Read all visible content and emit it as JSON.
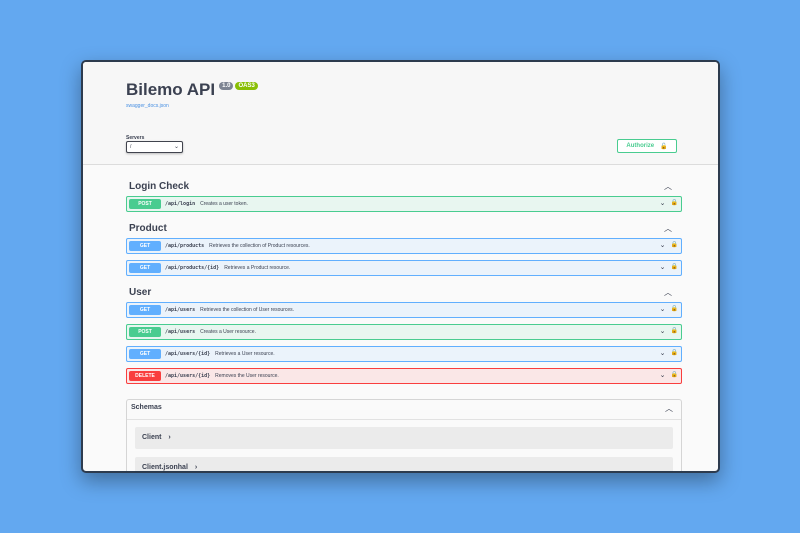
{
  "info": {
    "title": "Bilemo API",
    "version": "1.0",
    "oas": "OAS3",
    "doc_link": "swagger_docs.json"
  },
  "servers": {
    "label": "Servers",
    "selected": "/"
  },
  "authorize_label": "Authorize",
  "tags": [
    {
      "name": "Login Check",
      "operations": [
        {
          "method": "POST",
          "path": "/api/login",
          "summary": "Creates a user token."
        }
      ]
    },
    {
      "name": "Product",
      "operations": [
        {
          "method": "GET",
          "path": "/api/products",
          "summary": "Retrieves the collection of Product resources."
        },
        {
          "method": "GET",
          "path": "/api/products/{id}",
          "summary": "Retrieves a Product resource."
        }
      ]
    },
    {
      "name": "User",
      "operations": [
        {
          "method": "GET",
          "path": "/api/users",
          "summary": "Retrieves the collection of User resources."
        },
        {
          "method": "POST",
          "path": "/api/users",
          "summary": "Creates a User resource."
        },
        {
          "method": "GET",
          "path": "/api/users/{id}",
          "summary": "Retrieves a User resource."
        },
        {
          "method": "DELETE",
          "path": "/api/users/{id}",
          "summary": "Removes the User resource."
        }
      ]
    }
  ],
  "schemas": {
    "title": "Schemas",
    "models": [
      "Client",
      "Client.jsonhal"
    ]
  },
  "icons": {
    "collapse": "chevron-up-icon",
    "expand": "chevron-down-icon",
    "lock": "lock-icon",
    "model": "chevron-right-icon"
  },
  "colors": {
    "get": "#61affe",
    "post": "#49cc90",
    "delete": "#f93e3e",
    "background": "#63a8f0"
  }
}
